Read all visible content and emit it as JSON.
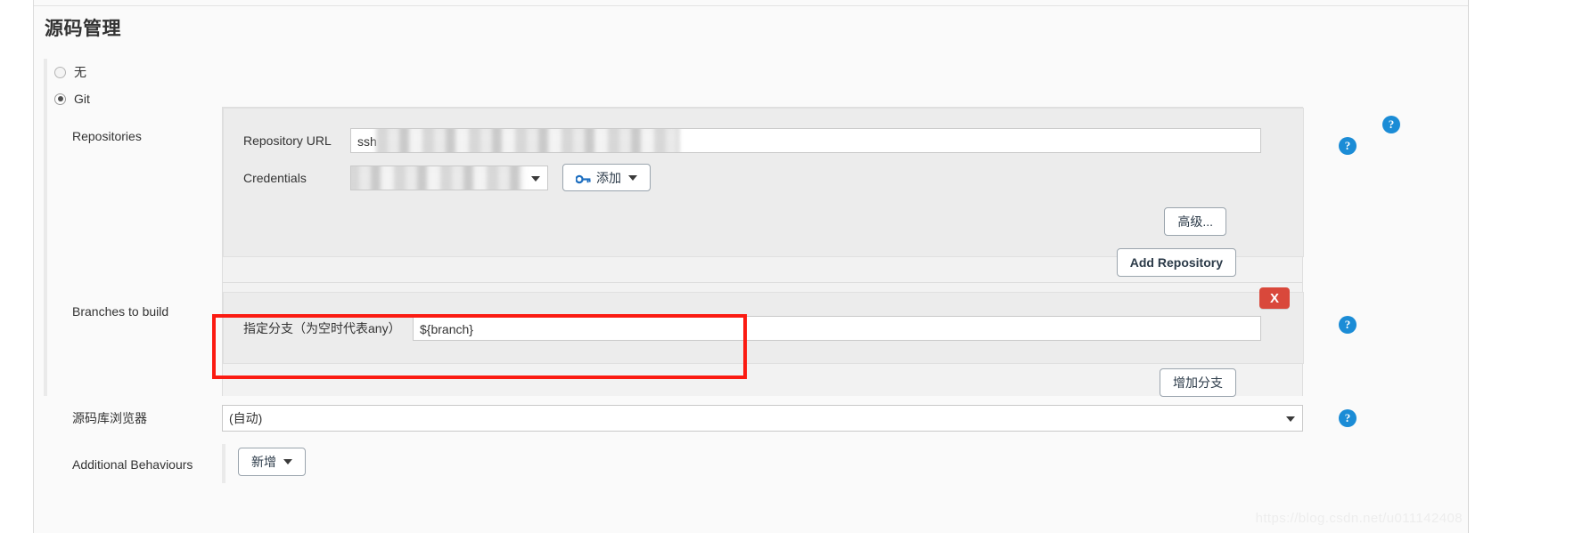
{
  "page": {
    "section_title": "源码管理",
    "watermark": "https://blog.csdn.net/u011142408"
  },
  "scm_options": [
    {
      "label": "无",
      "selected": false
    },
    {
      "label": "Git",
      "selected": true
    }
  ],
  "repositories": {
    "row_label": "Repositories",
    "repository_url": {
      "label": "Repository URL",
      "value": "ssh",
      "redacted": true,
      "help_icon": "help-icon"
    },
    "credentials": {
      "label": "Credentials",
      "value": "",
      "redacted": true,
      "add_button": "添加",
      "add_button_icon": "key-icon"
    },
    "advanced_button": "高级...",
    "add_repository_button": "Add Repository",
    "help_icon": "help-icon"
  },
  "branches": {
    "row_label": "Branches to build",
    "branch_spec": {
      "label": "指定分支（为空时代表any）",
      "value": "${branch}",
      "delete_button": "X",
      "help_icon": "help-icon"
    },
    "add_branch_button": "增加分支"
  },
  "repo_browser": {
    "label": "源码库浏览器",
    "value": "(自动)",
    "help_icon": "help-icon"
  },
  "additional_behaviours": {
    "label": "Additional Behaviours",
    "add_button": "新增"
  },
  "colors": {
    "accent_blue": "#1b8cd6",
    "danger_red": "#d9483b",
    "annotation_red": "#fb1b12",
    "panel_outer": "#f2f2f2",
    "panel_inner": "#ececec",
    "page_bg": "#fafafa"
  }
}
